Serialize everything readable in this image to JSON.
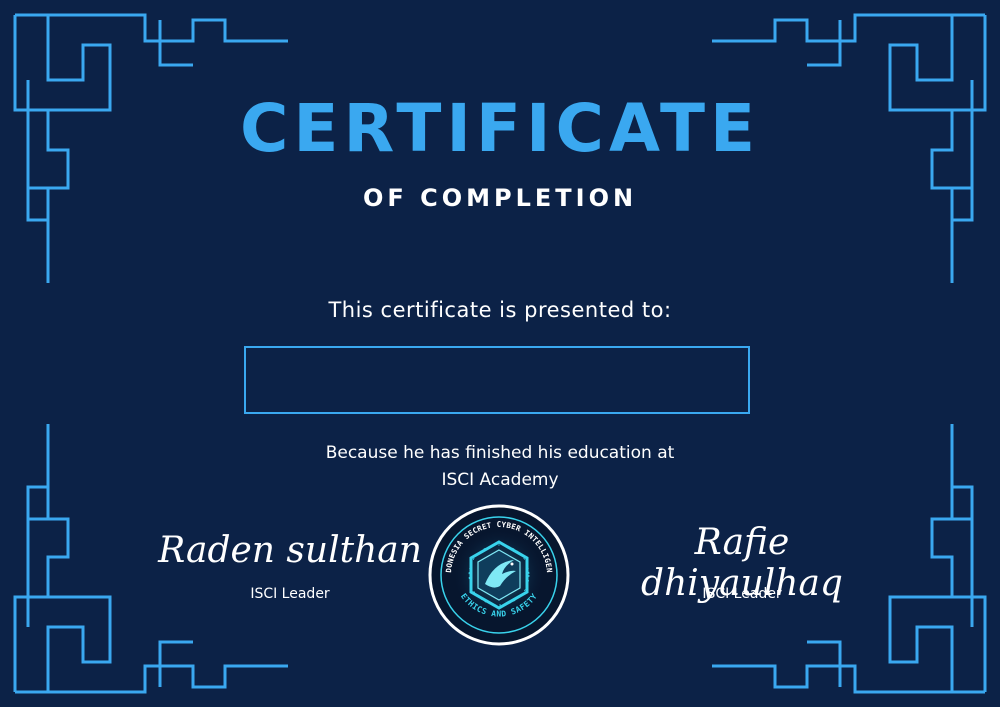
{
  "certificate": {
    "title": "CERTIFICATE",
    "subtitle": "OF COMPLETION",
    "presented_to": "This certificate is presented to:",
    "recipient_name": "",
    "reason_line1": "Because he has finished his education at",
    "reason_line2": "ISCI Academy"
  },
  "signatures": [
    {
      "name": "Raden sulthan",
      "role": "ISCI Leader"
    },
    {
      "name": "Rafie dhiyaulhaq",
      "role": "ISCI Leader"
    }
  ],
  "seal": {
    "top_text": "INDONESIA SECRET CYBER INTELLIGENCE",
    "bottom_text": "ETHICS AND SAFETY"
  },
  "colors": {
    "background": "#0c2247",
    "accent": "#3aa8f0",
    "text": "#ffffff",
    "seal_glow": "#39d3ec"
  },
  "icons": {
    "corner_ornament": "geometric-maze-corner-icon",
    "seal_emblem": "eagle-hexagon-icon"
  }
}
